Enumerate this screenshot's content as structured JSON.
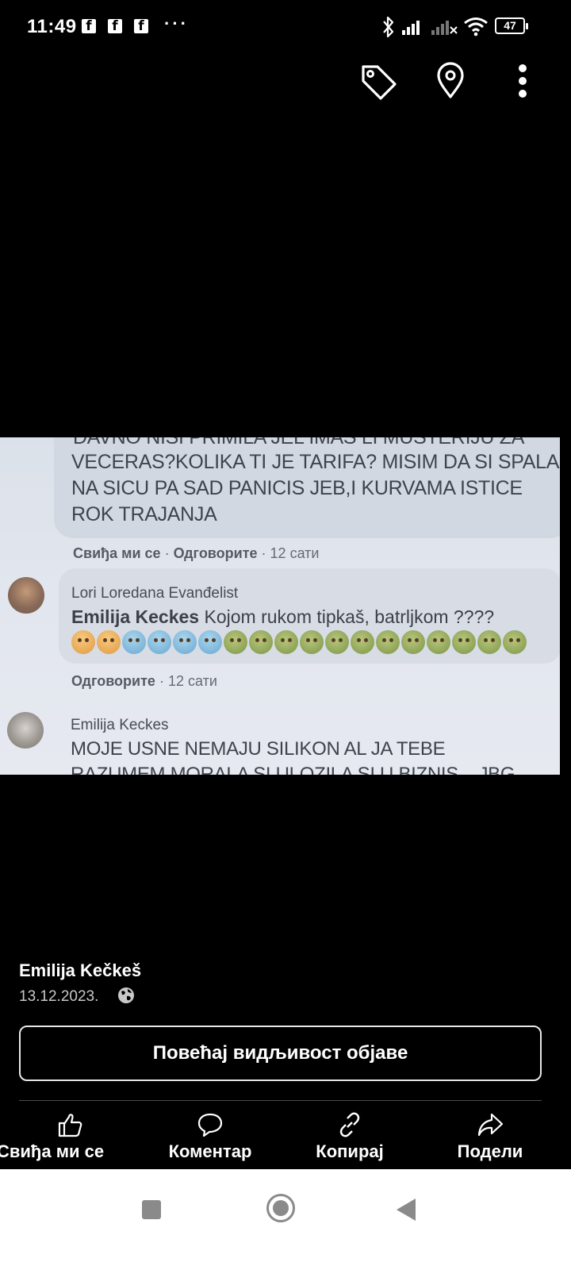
{
  "status_bar": {
    "time": "11:49",
    "notification_icons": [
      "facebook-icon",
      "facebook-icon",
      "facebook-icon"
    ],
    "more": "···",
    "battery": "47"
  },
  "top_actions": [
    "tag-icon",
    "location-pin-icon",
    "more-vertical-icon"
  ],
  "photo_text": {
    "partial_top": "DAVNO NISI PRIMILA JEL IMAS LI MUSTERIJU ZA",
    "comment1_lines": [
      "VECERAS?KOLIKA TI JE TARIFA? MISIM DA SI SPALA",
      "NA SICU PA SAD PANICIS JEB,I KURVAMA ISTICE",
      "ROK TRAJANJA"
    ],
    "comment1_meta": {
      "like": "Свиђа ми се",
      "sep": "·",
      "reply": "Одговорите",
      "time": "· 12 сати"
    },
    "comment2_author": "Lori Loredana Evanđelist",
    "comment2_mention": "Emilija Keckes",
    "comment2_text": " Kojom rukom tipkaš, batrljkom ????",
    "comment2_meta": {
      "reply": "Одговорите",
      "time": "· 12 сати"
    },
    "comment3_author": "Emilija Keckes",
    "comment3_line1": "MOJE USNE NEMAJU SILIKON AL JA TEBE",
    "comment3_line2": "RAZUMEM MORALA SI ULOZILA SI U BIZNIS ...JBG"
  },
  "post": {
    "author": "Emilija Kečkeš",
    "date": "13.12.2023.",
    "boost_label": "Повећај видљивост објаве"
  },
  "actions": {
    "like": "Свиђа ми се",
    "comment": "Коментар",
    "copy": "Копирај",
    "share": "Подели"
  },
  "colors": {
    "background": "#000000",
    "photo_bg": "#e2e6ee",
    "nav_bg": "#ffffff",
    "nav_icons": "#8a8a8a"
  }
}
